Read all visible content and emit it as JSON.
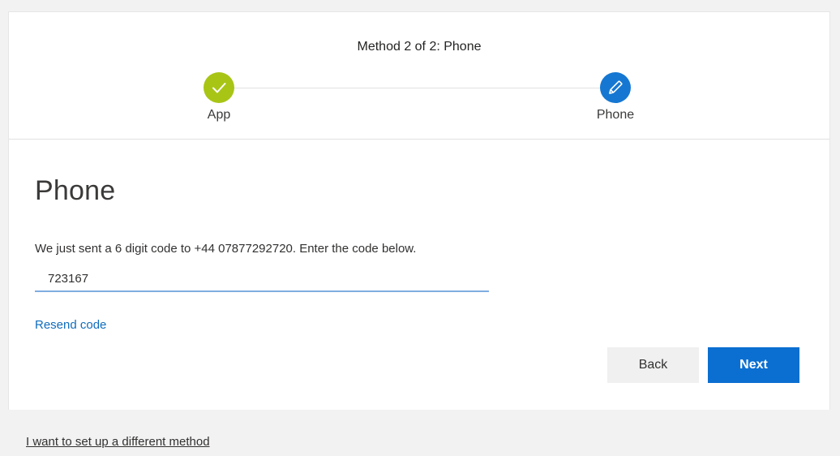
{
  "wizard": {
    "step_title": "Method 2 of 2: Phone",
    "steps": [
      {
        "label": "App",
        "status": "complete",
        "icon": "checkmark-icon",
        "color": "#a8c516"
      },
      {
        "label": "Phone",
        "status": "current",
        "icon": "pencil-icon",
        "color": "#1577d2"
      }
    ]
  },
  "main": {
    "title": "Phone",
    "instruction": "We just sent a 6 digit code to +44 07877292720. Enter the code below.",
    "code_value": "723167",
    "resend_label": "Resend code",
    "back_label": "Back",
    "next_label": "Next"
  },
  "footer": {
    "different_method_label": "I want to set up a different method"
  },
  "colors": {
    "accent": "#0b6fd1",
    "link": "#0f6cbd",
    "success": "#a8c516"
  }
}
